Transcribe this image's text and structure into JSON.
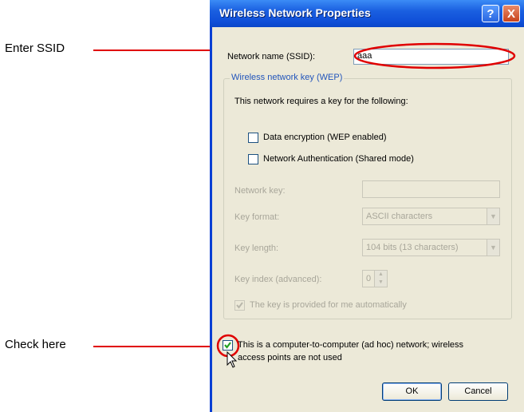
{
  "annotations": {
    "ssid_callout": "Enter SSID",
    "adhoc_callout": "Check here"
  },
  "window": {
    "title": "Wireless Network Properties",
    "help_glyph": "?",
    "close_glyph": "X"
  },
  "network_name": {
    "label": "Network name (SSID):",
    "value": "aaa"
  },
  "wep_group": {
    "title": "Wireless network key (WEP)",
    "intro": "This network requires a key for the following:",
    "data_encryption_label": "Data encryption (WEP enabled)",
    "data_encryption_checked": false,
    "network_auth_label": "Network Authentication (Shared mode)",
    "network_auth_checked": false,
    "network_key_label": "Network key:",
    "network_key_value": "",
    "key_format_label": "Key format:",
    "key_format_value": "ASCII characters",
    "key_length_label": "Key length:",
    "key_length_value": "104 bits (13 characters)",
    "key_index_label": "Key index (advanced):",
    "key_index_value": "0",
    "auto_key_label": "The key is provided for me automatically",
    "auto_key_checked": true
  },
  "adhoc": {
    "label_line1": "This is a computer-to-computer (ad hoc) network; wireless",
    "label_line2": "access points are not used",
    "checked": true
  },
  "buttons": {
    "ok": "OK",
    "cancel": "Cancel"
  },
  "colors": {
    "callout_red": "#e00000",
    "titlebar_blue": "#0f4fd8",
    "window_bg": "#ece9d8"
  }
}
